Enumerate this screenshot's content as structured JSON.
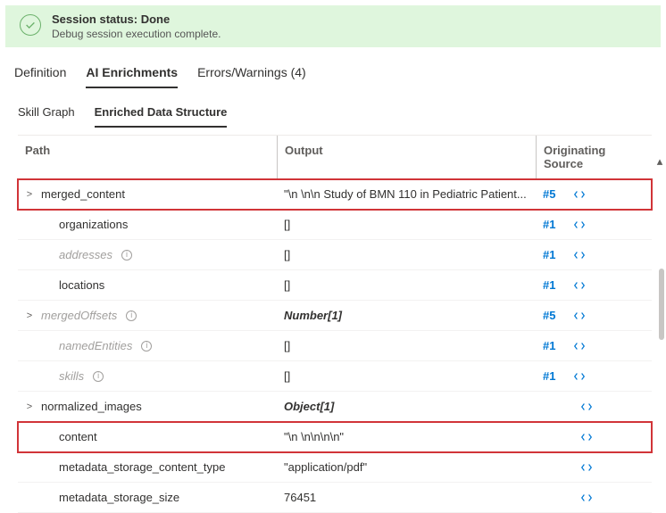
{
  "status": {
    "icon": "checkmark-icon",
    "title": "Session status: Done",
    "subtitle": "Debug session execution complete."
  },
  "main_tabs": {
    "definition": "Definition",
    "ai_enrichments": "AI Enrichments",
    "errors_warnings": "Errors/Warnings (4)"
  },
  "sub_tabs": {
    "skill_graph": "Skill Graph",
    "enriched_data": "Enriched Data Structure"
  },
  "columns": {
    "path": "Path",
    "output": "Output",
    "source": "Originating Source"
  },
  "rows": [
    {
      "name": "merged_content",
      "output": "\"\\n \\n\\n Study of BMN 110 in Pediatric Patient...",
      "source": "#5",
      "expandable": true,
      "indent": 0,
      "faded": false,
      "info": false,
      "italic": false,
      "highlight": true,
      "code": true
    },
    {
      "name": "organizations",
      "output": "[]",
      "source": "#1",
      "expandable": false,
      "indent": 1,
      "faded": false,
      "info": false,
      "italic": false,
      "highlight": false,
      "code": true
    },
    {
      "name": "addresses",
      "output": "[]",
      "source": "#1",
      "expandable": false,
      "indent": 1,
      "faded": true,
      "info": true,
      "italic": false,
      "highlight": false,
      "code": true
    },
    {
      "name": "locations",
      "output": "[]",
      "source": "#1",
      "expandable": false,
      "indent": 1,
      "faded": false,
      "info": false,
      "italic": false,
      "highlight": false,
      "code": true
    },
    {
      "name": "mergedOffsets",
      "output": "Number[1]",
      "source": "#5",
      "expandable": true,
      "indent": 0,
      "faded": true,
      "info": true,
      "italic": true,
      "highlight": false,
      "code": true
    },
    {
      "name": "namedEntities",
      "output": "[]",
      "source": "#1",
      "expandable": false,
      "indent": 1,
      "faded": true,
      "info": true,
      "italic": false,
      "highlight": false,
      "code": true
    },
    {
      "name": "skills",
      "output": "[]",
      "source": "#1",
      "expandable": false,
      "indent": 1,
      "faded": true,
      "info": true,
      "italic": false,
      "highlight": false,
      "code": true
    },
    {
      "name": "normalized_images",
      "output": "Object[1]",
      "source": "",
      "expandable": true,
      "indent": 0,
      "faded": false,
      "info": false,
      "italic": true,
      "highlight": false,
      "code": true
    },
    {
      "name": "content",
      "output": "\"\\n \\n\\n\\n\\n\"",
      "source": "",
      "expandable": false,
      "indent": 1,
      "faded": false,
      "info": false,
      "italic": false,
      "highlight": true,
      "code": true
    },
    {
      "name": "metadata_storage_content_type",
      "output": "\"application/pdf\"",
      "source": "",
      "expandable": false,
      "indent": 1,
      "faded": false,
      "info": false,
      "italic": false,
      "highlight": false,
      "code": true
    },
    {
      "name": "metadata_storage_size",
      "output": "76451",
      "source": "",
      "expandable": false,
      "indent": 1,
      "faded": false,
      "info": false,
      "italic": false,
      "highlight": false,
      "code": true
    }
  ]
}
